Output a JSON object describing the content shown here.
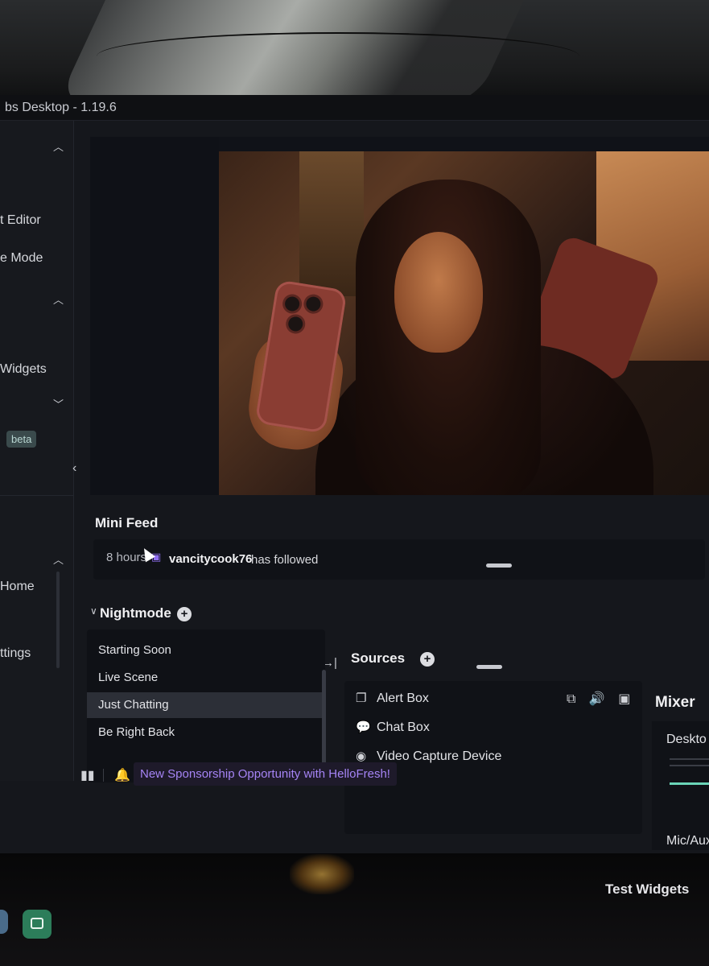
{
  "window": {
    "title": "bs Desktop - 1.19.6"
  },
  "sidebar": {
    "items": [
      {
        "label": "t Editor"
      },
      {
        "label": "e Mode"
      },
      {
        "label": "Widgets"
      },
      {
        "label": "Home"
      },
      {
        "label": "ttings"
      }
    ],
    "beta_badge": "beta"
  },
  "mini_feed": {
    "title": "Mini Feed",
    "event": {
      "time": "8 hours",
      "platform_icon": "twitch-icon",
      "user": "vancitycook76",
      "action": "has followed"
    }
  },
  "scenes": {
    "collection": "Nightmode",
    "items": [
      {
        "label": "Starting Soon",
        "active": false
      },
      {
        "label": "Live Scene",
        "active": false
      },
      {
        "label": "Just Chatting",
        "active": true
      },
      {
        "label": "Be Right Back",
        "active": false
      }
    ]
  },
  "sources": {
    "title": "Sources",
    "items": [
      {
        "label": "Alert Box",
        "icon": "alert-box-icon"
      },
      {
        "label": "Chat Box",
        "icon": "chat-box-icon"
      },
      {
        "label": "Video Capture Device",
        "icon": "webcam-icon"
      }
    ]
  },
  "mixer": {
    "title": "Mixer",
    "channels": [
      {
        "label": "Deskto"
      },
      {
        "label": "Mic/Aux"
      }
    ]
  },
  "footer": {
    "notification": "New Sponsorship Opportunity with HelloFresh!",
    "test_widgets": "Test Widgets"
  },
  "colors": {
    "accent_purple": "#a584f5",
    "meter_green": "#6bd5b8",
    "beta_bg": "#3a4a4c"
  }
}
